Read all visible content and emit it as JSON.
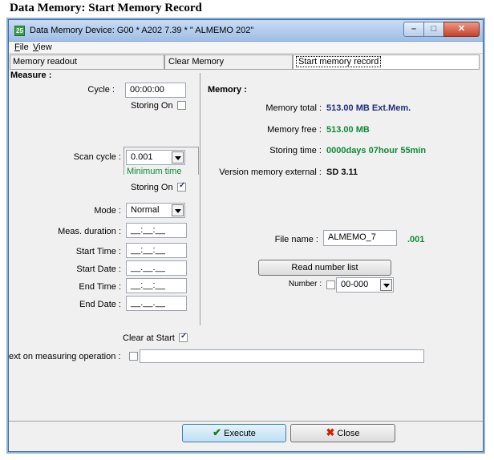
{
  "caption": "Data Memory: Start Memory Record",
  "window": {
    "title": "Data Memory  Device: G00 * A202 7.39 * \"  ALMEMO 202\"",
    "app_icon": "almemo-app-icon",
    "app_icon_text": "25"
  },
  "menu": {
    "file": "File",
    "view": "View"
  },
  "tabs": {
    "memory_readout": "Memory readout",
    "clear_memory": "Clear Memory",
    "start_memory_record": "Start memory record"
  },
  "measure": {
    "section_title": "Measure :",
    "cycle_label": "Cycle :",
    "cycle_value": "00:00:00",
    "storing_on_label": "Storing On",
    "storing_on_1_checked": false,
    "scan_cycle_label": "Scan cycle :",
    "scan_cycle_value": "0.001",
    "minimum_time": "Minimum time",
    "storing_on_2_checked": true,
    "mode_label": "Mode :",
    "mode_value": "Normal",
    "meas_duration_label": "Meas. duration :",
    "meas_duration_value": "__:__:__",
    "start_time_label": "Start Time :",
    "start_time_value": "__:__:__",
    "start_date_label": "Start Date :",
    "start_date_value": "__.__.__",
    "end_time_label": "End Time :",
    "end_time_value": "__:__:__",
    "end_date_label": "End Date :",
    "end_date_value": "__.__.__",
    "clear_at_start_label": "Clear at Start",
    "clear_at_start_checked": true
  },
  "memory": {
    "section_title": "Memory :",
    "total_label": "Memory total :",
    "total_value": "513.00 MB  Ext.Mem.",
    "free_label": "Memory free :",
    "free_value": "513.00 MB",
    "storing_time_label": "Storing time :",
    "storing_time_value": "0000days 07hour 55min",
    "version_label": "Version memory external :",
    "version_value": "SD 3.11",
    "file_name_label": "File name :",
    "file_name_value": "ALMEMO_7",
    "file_ext": ".001",
    "read_number_list": "Read number list",
    "number_label": "Number :",
    "number_value": "00-000"
  },
  "text_on_measuring": {
    "label": "ext on measuring operation :",
    "value": ""
  },
  "buttons": {
    "execute": "Execute",
    "close": "Close"
  },
  "colors": {
    "accent_blue": "#1f2f7a",
    "accent_green": "#0e8a3a"
  }
}
